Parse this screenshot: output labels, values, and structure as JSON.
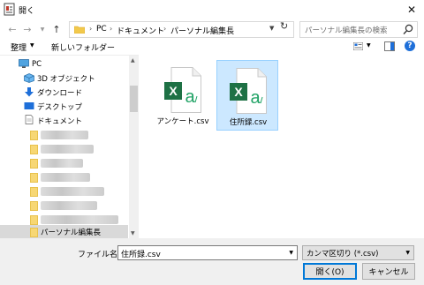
{
  "window": {
    "title": "開く",
    "close_glyph": "✕"
  },
  "address": {
    "crumbs": [
      "PC",
      "ドキュメント",
      "パーソナル編集長"
    ],
    "search_placeholder": "パーソナル編集長の検索"
  },
  "toolbar": {
    "organize_label": "整理",
    "new_folder_label": "新しいフォルダー",
    "help_glyph": "?"
  },
  "nav": {
    "pc_label": "PC",
    "items": [
      {
        "label": "3D オブジェクト"
      },
      {
        "label": "ダウンロード"
      },
      {
        "label": "デスクトップ"
      },
      {
        "label": "ドキュメント"
      }
    ],
    "selected_label": "パーソナル編集長"
  },
  "files": [
    {
      "name": "アンケート.csv",
      "selected": false
    },
    {
      "name": "住所録.csv",
      "selected": true
    }
  ],
  "file_icon_letters": {
    "excel": "X",
    "a": "a"
  },
  "bottom": {
    "filename_label": "ファイル名(N):",
    "filename_value": "住所録.csv",
    "filter_value": "カンマ区切り (*.csv)",
    "open_label": "開く(O)",
    "cancel_label": "キャンセル"
  },
  "colors": {
    "excel_green": "#1e7145",
    "selection": "#cce8ff",
    "accent": "#0078d7"
  }
}
